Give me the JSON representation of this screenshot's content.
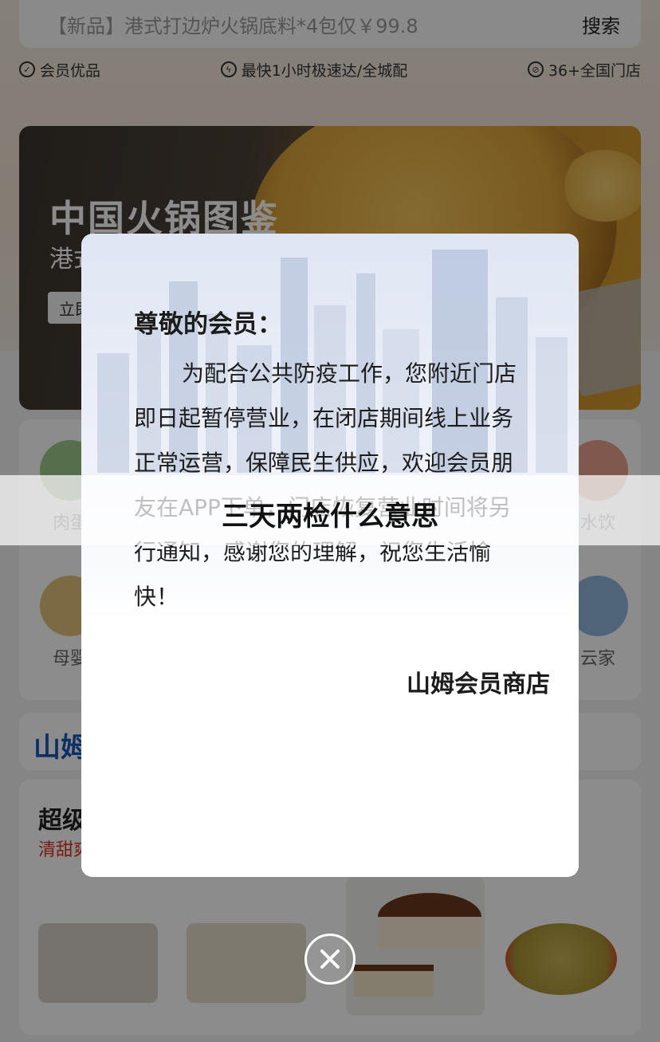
{
  "search": {
    "placeholder": "【新品】港式打边炉火锅底料*4包仅￥99.8",
    "button": "搜索"
  },
  "features": [
    {
      "icon": "check-circle-icon",
      "label": "会员优品"
    },
    {
      "icon": "lightning-circle-icon",
      "label": "最快1小时极速达/全城配"
    },
    {
      "icon": "store-circle-icon",
      "label": "36+全国门店"
    }
  ],
  "banner": {
    "title": "中国火锅图鉴",
    "subtitle": "港式",
    "button": "立即"
  },
  "categories": [
    {
      "label": "肉蛋",
      "color": "#9ec88a"
    },
    {
      "label": "水饮",
      "color": "#e9a08c"
    },
    {
      "label": "母婴",
      "color": "#e2c27d"
    },
    {
      "label": "云家",
      "color": "#93b7dd"
    }
  ],
  "shanmu": {
    "logo": "山姆"
  },
  "super_section": {
    "title": "超级",
    "subtitle": "清甜爽"
  },
  "modal": {
    "heading": "尊敬的会员：",
    "body": "为配合公共防疫工作，您附近门店即日起暂停营业，在闭店期间线上业务正常运营，保障民生供应，欢迎会员朋友在APP下单，门店恢复营业时间将另行通知，感谢您的理解，祝您生活愉快！",
    "signature": "山姆会员商店"
  },
  "caption": "三天两检什么意思",
  "colors": {
    "accent_red": "#e0301e",
    "brand_blue": "#1a56b8"
  }
}
